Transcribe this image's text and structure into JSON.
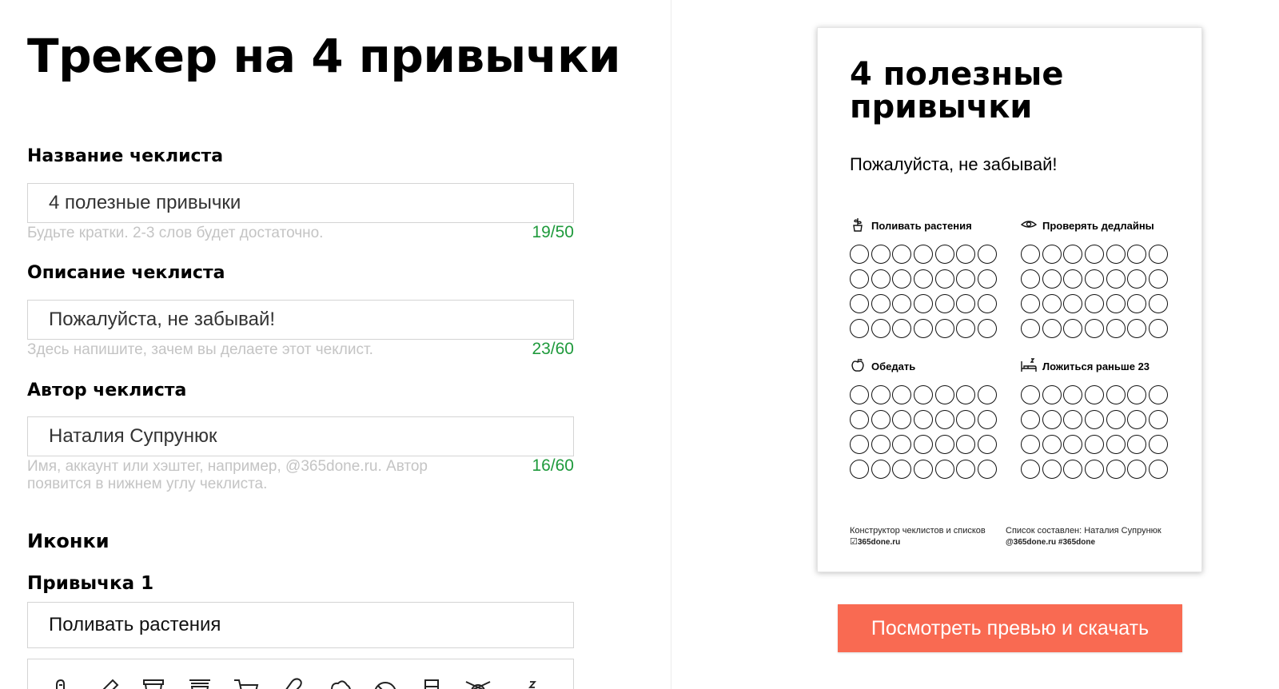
{
  "page": {
    "title": "Трекер на 4 привычки"
  },
  "form": {
    "title_field": {
      "label": "Название чеклиста",
      "value": "4 полезные привычки",
      "hint": "Будьте кратки. 2-3 слов будет достаточно.",
      "counter": "19/50"
    },
    "description_field": {
      "label": "Описание чеклиста",
      "value": "Пожалуйста, не забывай!",
      "hint": "Здесь напишите, зачем вы делаете этот чеклист.",
      "counter": "23/60"
    },
    "author_field": {
      "label": "Автор чеклиста",
      "value": "Наталия Супрунюк",
      "hint": "Имя, аккаунт или хэштег, например, @365done.ru. Автор появится в нижнем углу чеклиста.",
      "counter": "16/60"
    },
    "icons_section": {
      "title": "Иконки"
    },
    "habit1": {
      "label": "Привычка 1",
      "value": "Поливать растения"
    },
    "icon_options": [
      "hand-icon",
      "pencil-icon",
      "cup-icon",
      "coffee-cup-icon",
      "cart-icon",
      "pill-icon",
      "cloud-icon",
      "no-smoking-icon",
      "glass-icon",
      "knitting-icon",
      "sleep-icon"
    ]
  },
  "preview": {
    "title": "4 полезные привычки",
    "description": "Пожалуйста, не забывай!",
    "habits": [
      {
        "name": "Поливать растения",
        "icon": "plant-icon",
        "circles": 28
      },
      {
        "name": "Проверять дедлайны",
        "icon": "eye-icon",
        "circles": 28
      },
      {
        "name": "Обедать",
        "icon": "apple-icon",
        "circles": 28
      },
      {
        "name": "Ложиться раньше 23",
        "icon": "bed-icon",
        "circles": 28
      }
    ],
    "footer": {
      "left_line1": "Конструктор чеклистов и списков",
      "left_line2": "365done.ru",
      "right_line1": "Список составлен: Наталия Супрунюк",
      "right_line2": "@365done.ru  #365done"
    }
  },
  "cta": {
    "label": "Посмотреть превью и скачать",
    "color": "#f96a52"
  },
  "colors": {
    "counter": "#1f9a3c",
    "hint": "#c4c4c4"
  }
}
